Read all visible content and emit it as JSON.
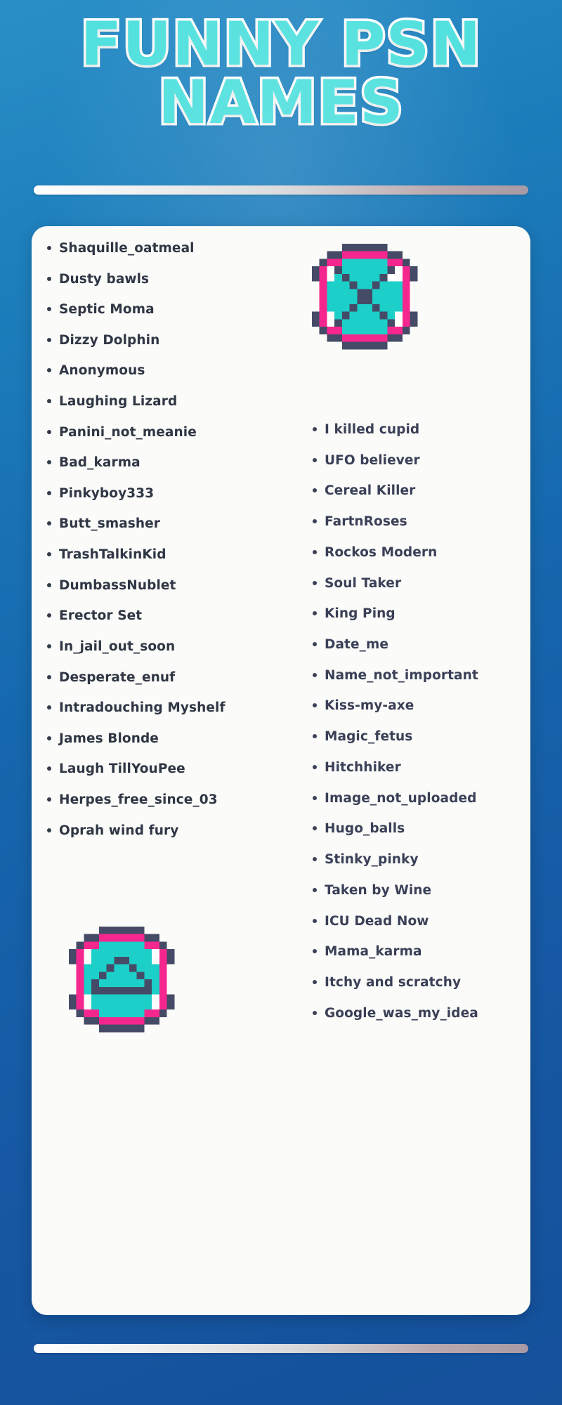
{
  "theme": {
    "background_blue": "#1668ae",
    "title_fill": "#4ee0dd",
    "title_outline": "#ffffff",
    "card_background": "#fbfbf9",
    "text_navy": "#2f3644",
    "icon_teal": "#1ccfc9",
    "icon_pink": "#f5278f",
    "icon_navy": "#454b67"
  },
  "header": {
    "title_line_1": "FUNNY PSN",
    "title_line_2": "NAMES"
  },
  "icons": {
    "top": "pixel-x-circle-icon",
    "bottom": "pixel-cloud-circle-icon"
  },
  "lists": {
    "left_column": [
      {
        "label": "Shaquille_oatmeal"
      },
      {
        "label": "Dusty bawls"
      },
      {
        "label": "Septic Moma"
      },
      {
        "label": "Dizzy Dolphin"
      },
      {
        "label": "Anonymous"
      },
      {
        "label": "Laughing Lizard"
      },
      {
        "label": "Panini_not_meanie"
      },
      {
        "label": "Bad_karma"
      },
      {
        "label": "Pinkyboy333"
      },
      {
        "label": "Butt_smasher"
      },
      {
        "label": "TrashTalkinKid"
      },
      {
        "label": "DumbassNublet"
      },
      {
        "label": "Erector Set"
      },
      {
        "label": "In_jail_out_soon"
      },
      {
        "label": "Desperate_enuf"
      },
      {
        "label": "Intradouching Myshelf"
      },
      {
        "label": "James Blonde"
      },
      {
        "label": "Laugh TillYouPee"
      },
      {
        "label": "Herpes_free_since_03"
      },
      {
        "label": "Oprah wind fury"
      }
    ],
    "right_column": [
      {
        "label": "I killed cupid"
      },
      {
        "label": "UFO believer"
      },
      {
        "label": "Cereal Killer"
      },
      {
        "label": "FartnRoses"
      },
      {
        "label": "Rockos Modern"
      },
      {
        "label": "Soul Taker"
      },
      {
        "label": "King Ping"
      },
      {
        "label": "Date_me"
      },
      {
        "label": "Name_not_important"
      },
      {
        "label": "Kiss-my-axe"
      },
      {
        "label": "Magic_fetus"
      },
      {
        "label": "Hitchhiker"
      },
      {
        "label": "Image_not_uploaded"
      },
      {
        "label": "Hugo_balls"
      },
      {
        "label": "Stinky_pinky"
      },
      {
        "label": "Taken by Wine"
      },
      {
        "label": "ICU Dead Now"
      },
      {
        "label": "Mama_karma"
      },
      {
        "label": "Itchy and scratchy"
      },
      {
        "label": "Google_was_my_idea"
      }
    ]
  }
}
